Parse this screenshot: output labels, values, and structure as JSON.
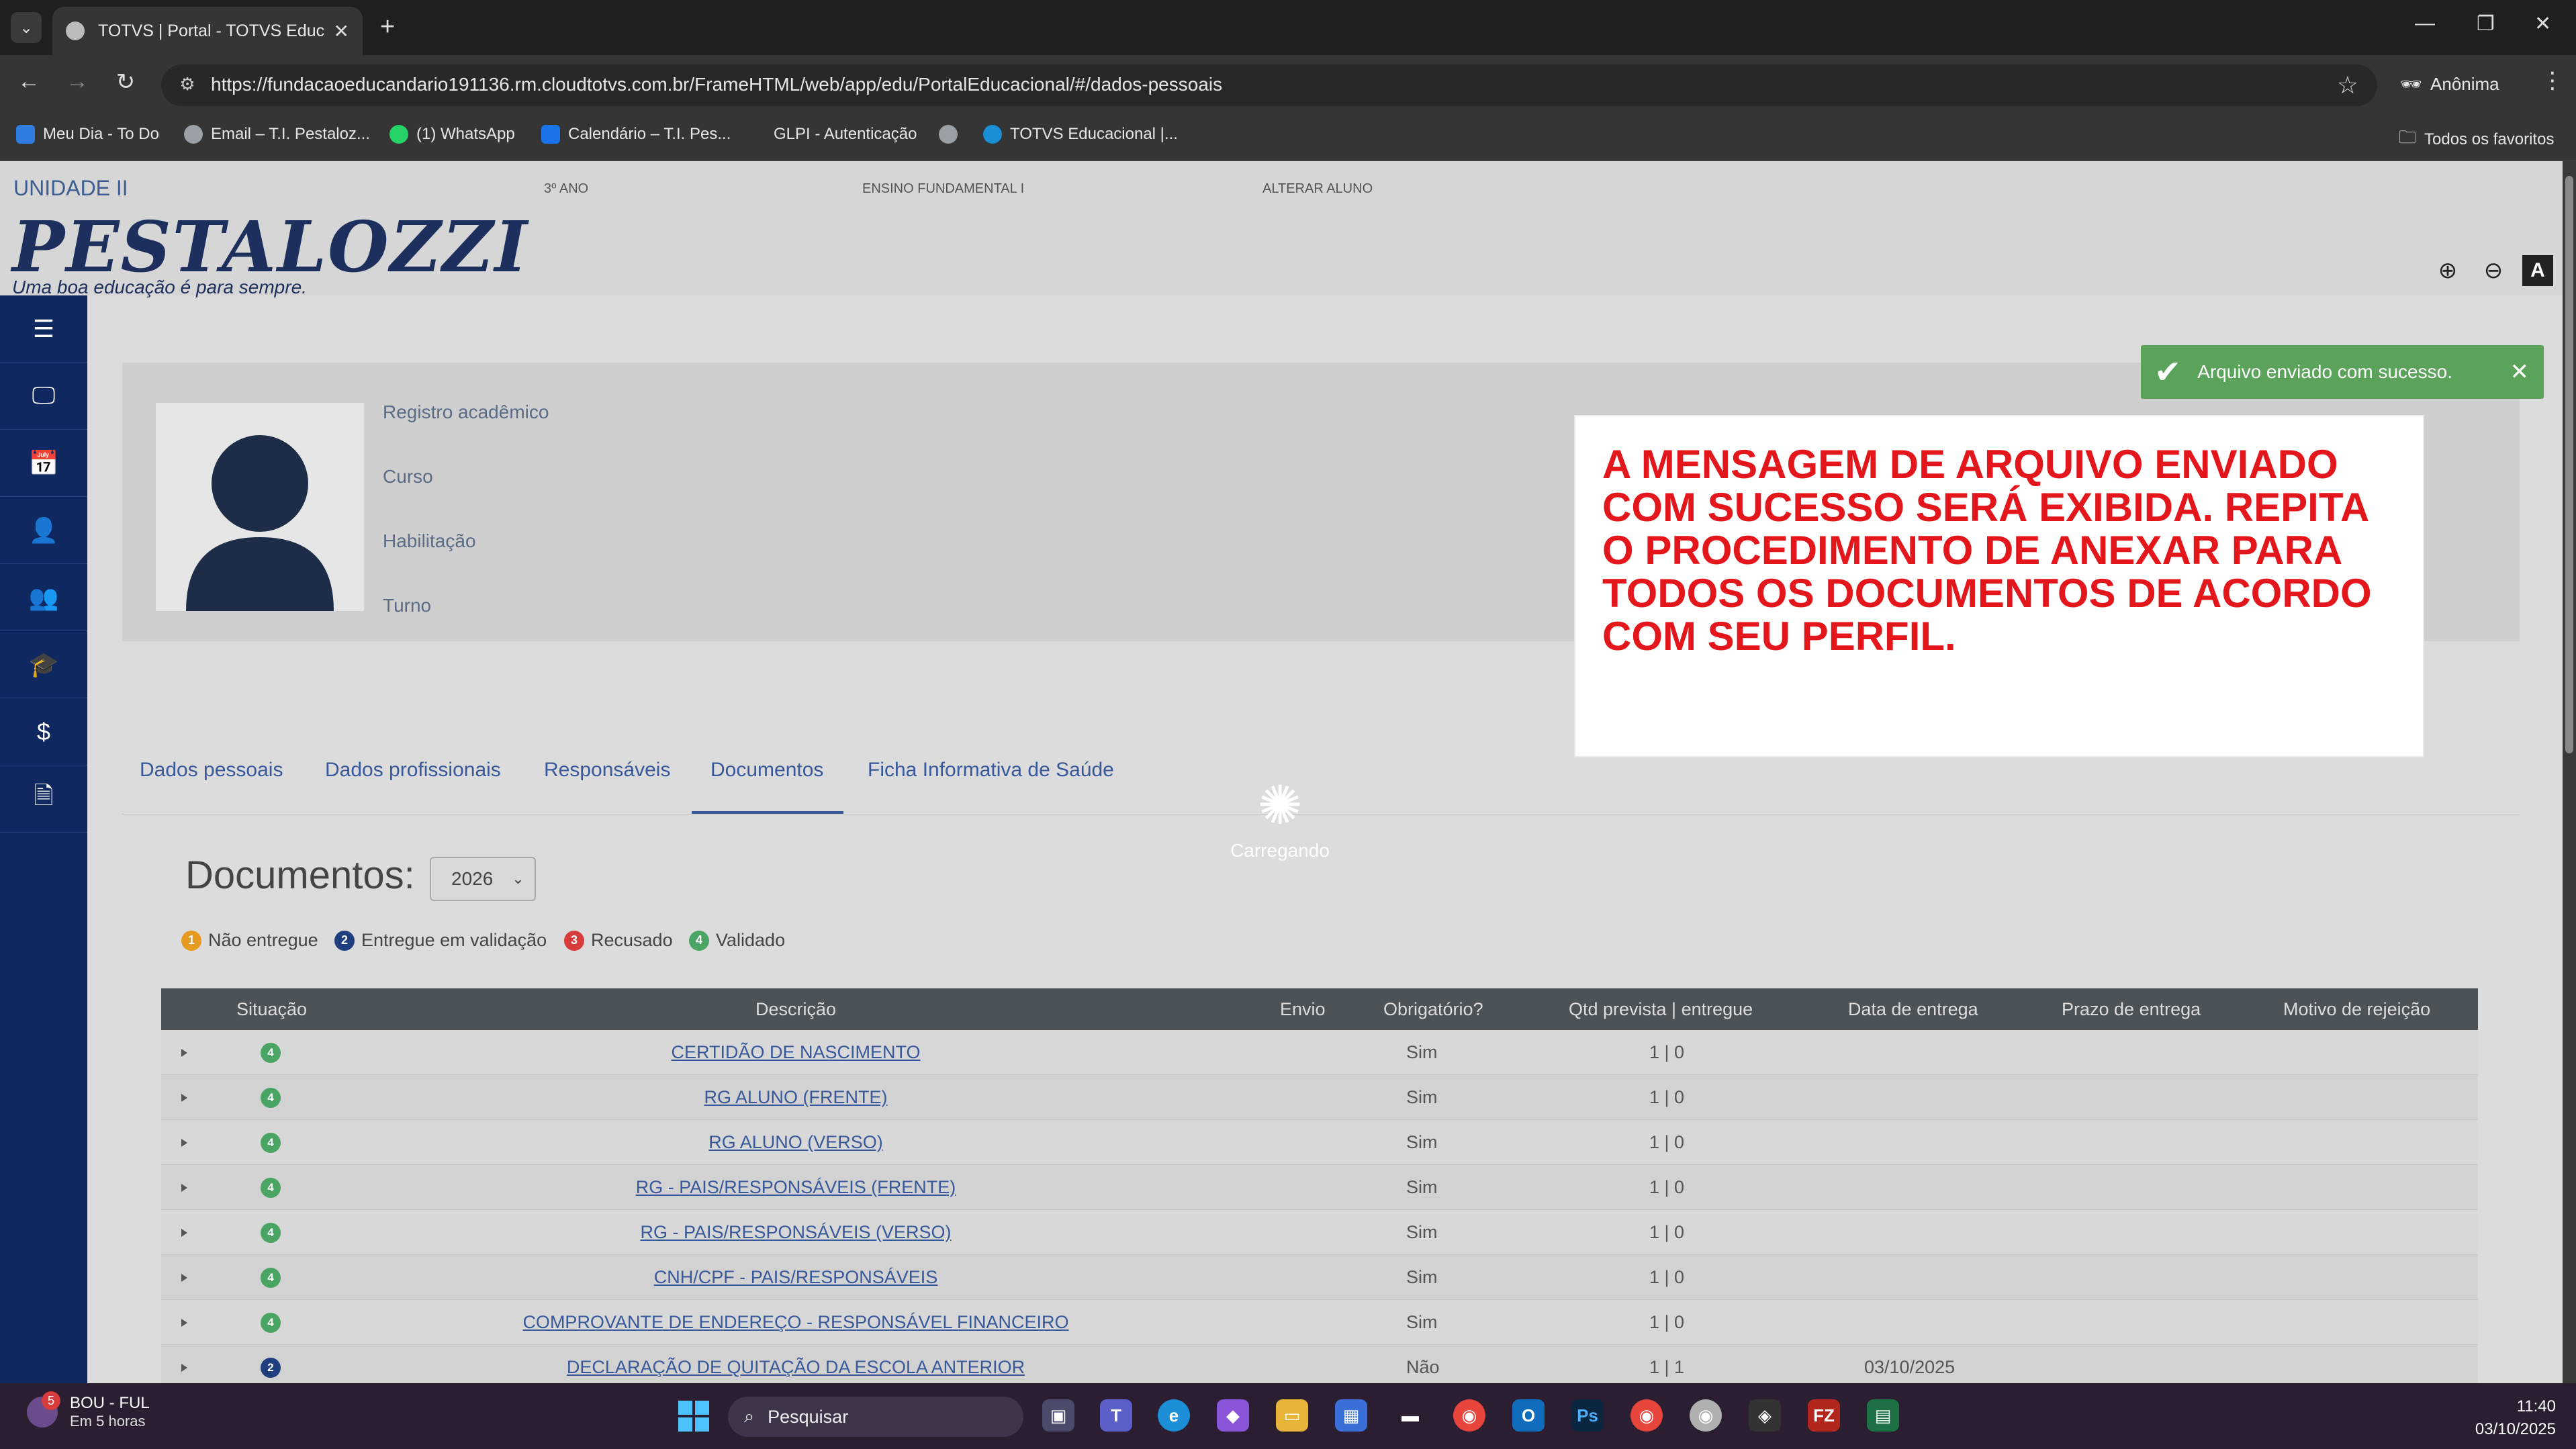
{
  "browser": {
    "tab_title": "TOTVS | Portal - TOTVS Educac",
    "new_tab": "+",
    "url": "https://fundacaoeducandario191136.rm.cloudtotvs.com.br/FrameHTML/web/app/edu/PortalEducacional/#/dados-pessoais",
    "profile_label": "Anônima",
    "bookmarks": [
      {
        "label": "Meu Dia - To Do",
        "icon": "todo-icon",
        "color": "#2f7de1"
      },
      {
        "label": "Email – T.I. Pestaloz...",
        "icon": "globe-icon",
        "color": "#9aa0a6"
      },
      {
        "label": "(1) WhatsApp",
        "icon": "whatsapp-icon",
        "color": "#25d366"
      },
      {
        "label": "Calendário – T.I. Pes...",
        "icon": "calendar-icon",
        "color": "#1a73e8"
      },
      {
        "label": "GLPI - Autenticação",
        "icon": "glpi-icon",
        "color": "#353535"
      },
      {
        "label": "",
        "icon": "globe-icon",
        "color": "#9aa0a6"
      },
      {
        "label": "TOTVS Educacional |...",
        "icon": "totvs-icon",
        "color": "#1a8fd8"
      }
    ],
    "all_bookmarks": "Todos os favoritos"
  },
  "header": {
    "unit": "UNIDADE II",
    "grade": "3º ANO",
    "level": "ENSINO FUNDAMENTAL I",
    "change_student": "ALTERAR ALUNO",
    "logo_main": "PESTALOZZI",
    "logo_sub": "Uma boa educação é para sempre."
  },
  "sidebar": {
    "items": [
      "menu-icon",
      "monitor-icon",
      "calendar-icon",
      "user-check-icon",
      "user-plus-icon",
      "graduation-cap-icon",
      "dollar-icon",
      "document-icon"
    ]
  },
  "profile": {
    "labels": [
      "Registro acadêmico",
      "Curso",
      "Habilitação",
      "Turno"
    ]
  },
  "tabs": [
    "Dados pessoais",
    "Dados profissionais",
    "Responsáveis",
    "Documentos",
    "Ficha Informativa de Saúde"
  ],
  "active_tab": "Documentos",
  "loading_text": "Carregando",
  "documents": {
    "title": "Documentos:",
    "year": "2026",
    "legend": [
      {
        "num": "1",
        "label": "Não entregue",
        "color": "#e69a1f"
      },
      {
        "num": "2",
        "label": "Entregue em validação",
        "color": "#1f3f7f"
      },
      {
        "num": "3",
        "label": "Recusado",
        "color": "#d83b3b"
      },
      {
        "num": "4",
        "label": "Validado",
        "color": "#4aa564"
      }
    ],
    "columns": [
      "Situação",
      "Descrição",
      "Envio",
      "Obrigatório?",
      "Qtd prevista | entregue",
      "Data de entrega",
      "Prazo de entrega",
      "Motivo de rejeição"
    ],
    "rows": [
      {
        "status": "4",
        "desc": "CERTIDÃO DE NASCIMENTO",
        "required": "Sim",
        "qty": "1 | 0",
        "date": ""
      },
      {
        "status": "4",
        "desc": "RG ALUNO (FRENTE)",
        "required": "Sim",
        "qty": "1 | 0",
        "date": ""
      },
      {
        "status": "4",
        "desc": "RG ALUNO (VERSO)",
        "required": "Sim",
        "qty": "1 | 0",
        "date": ""
      },
      {
        "status": "4",
        "desc": "RG - PAIS/RESPONSÁVEIS (FRENTE)",
        "required": "Sim",
        "qty": "1 | 0",
        "date": ""
      },
      {
        "status": "4",
        "desc": "RG - PAIS/RESPONSÁVEIS (VERSO)",
        "required": "Sim",
        "qty": "1 | 0",
        "date": ""
      },
      {
        "status": "4",
        "desc": "CNH/CPF - PAIS/RESPONSÁVEIS",
        "required": "Sim",
        "qty": "1 | 0",
        "date": ""
      },
      {
        "status": "4",
        "desc": "COMPROVANTE DE ENDEREÇO - RESPONSÁVEL FINANCEIRO",
        "required": "Sim",
        "qty": "1 | 0",
        "date": ""
      },
      {
        "status": "2",
        "desc": "DECLARAÇÃO DE QUITAÇÃO DA ESCOLA ANTERIOR",
        "required": "Não",
        "qty": "1 | 1",
        "date": "03/10/2025"
      }
    ]
  },
  "notice": "A MENSAGEM DE ARQUIVO ENVIADO COM SUCESSO SERÁ EXIBIDA. REPITA O PROCEDIMENTO DE ANEXAR PARA TODOS OS DOCUMENTOS DE ACORDO COM SEU PERFIL.",
  "toast": {
    "text": "Arquivo enviado com sucesso.",
    "color": "#5ba35b"
  },
  "taskbar": {
    "weather_badge": "5",
    "weather_title": "BOU - FUL",
    "weather_sub": "Em 5 horas",
    "search_placeholder": "Pesquisar",
    "time": "11:40",
    "date": "03/10/2025"
  }
}
